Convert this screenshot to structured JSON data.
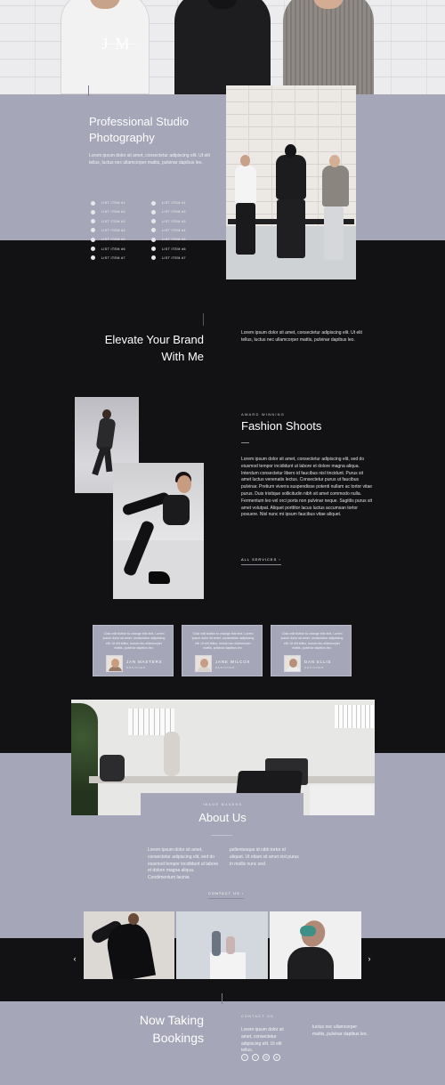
{
  "brand": {
    "logo_text": "JM"
  },
  "colors": {
    "accent": "#a5a6b7",
    "dark": "#121214",
    "text": "#ffffff"
  },
  "intro": {
    "title": "Professional Studio Photography",
    "body": "Lorem ipsum dolor sit amet, consectetur adipiscing elit. Ut elit tellus, luctus nec ullamcorper mattis, pulvinar dapibus leo.",
    "list_col1": [
      "List Item #1",
      "List Item #2",
      "List Item #3",
      "List Item #4",
      "List Item #5",
      "List Item #6",
      "List Item #7"
    ],
    "list_col2": [
      "List Item #1",
      "List Item #2",
      "List Item #3",
      "List Item #4",
      "List Item #5",
      "List Item #6",
      "List Item #7"
    ]
  },
  "elevate": {
    "title": "Elevate Your Brand With Me",
    "body": "Lorem ipsum dolor sit amet, consectetur adipiscing elit. Ut elit tellus, luctus nec ullamcorper mattis, pulvinar dapibus leo."
  },
  "fashion": {
    "eyebrow": "Award Winning",
    "title": "Fashion Shoots",
    "body": "Lorem ipsum dolor sit amet, consectetur adipiscing elit, sed do eiusmod tempor incididunt ut labore et dolore magna aliqua. Interdum consectetur libero id faucibus nisl tincidunt. Purus sit amet luctus venenatis lectus. Consectetur purus ut faucibus pulvinar. Pretium viverra suspendisse potenti nullam ac tortor vitae purus. Duis tristique sollicitudin nibh sit amet commodo nulla. Fermentum leo vel orci porta non pulvinar neque. Sagittis purus sit amet volutpat. Aliquet porttitor lacus luctus accumsan tortor posuere. Nisl nunc mi ipsum faucibus vitae aliquet.",
    "link": "All Services ›"
  },
  "testimonials": [
    {
      "quote": "Click edit button to change this text. Lorem ipsum dolor sit amet, consectetur adipiscing elit. Ut elit tellus, luctus nec ullamcorper mattis, pulvinar dapibus leo.",
      "name": "Jan Masters",
      "role": "Designer"
    },
    {
      "quote": "Click edit button to change this text. Lorem ipsum dolor sit amet, consectetur adipiscing elit. Ut elit tellus, luctus nec ullamcorper mattis, pulvinar dapibus leo.",
      "name": "Jane Wilcox",
      "role": "Designer"
    },
    {
      "quote": "Click edit button to change this text. Lorem ipsum dolor sit amet, consectetur adipiscing elit. Ut elit tellus, luctus nec ullamcorper mattis, pulvinar dapibus leo.",
      "name": "Dan Ellis",
      "role": "Designer"
    }
  ],
  "about": {
    "eyebrow": "Image Makers",
    "title": "About Us",
    "col1": "Lorem ipsum dolor sit amet, consectetur adipiscing elit, sed do eiusmod tempor incididunt ut labore et dolore magna aliqua. Condimentum lacinia",
    "col2": "pellentesque id nibh tortor id aliquet. Ut etiam sit amet nisl purus in mollis nunc sed.",
    "link": "Contact Us ›"
  },
  "gallery": {
    "prev": "‹",
    "next": "›"
  },
  "bookings": {
    "title": "Now Taking Bookings",
    "eyebrow": "Contact Us",
    "col1": "Lorem ipsum dolor sit amet, consectetur adipiscing elit. Ut elit tellus,",
    "col2": "luctus nec ullamcorper mattis, pulvinar dapibus leo.",
    "social_icons": [
      "facebook-icon",
      "twitter-icon",
      "instagram-icon",
      "pinterest-icon"
    ]
  }
}
